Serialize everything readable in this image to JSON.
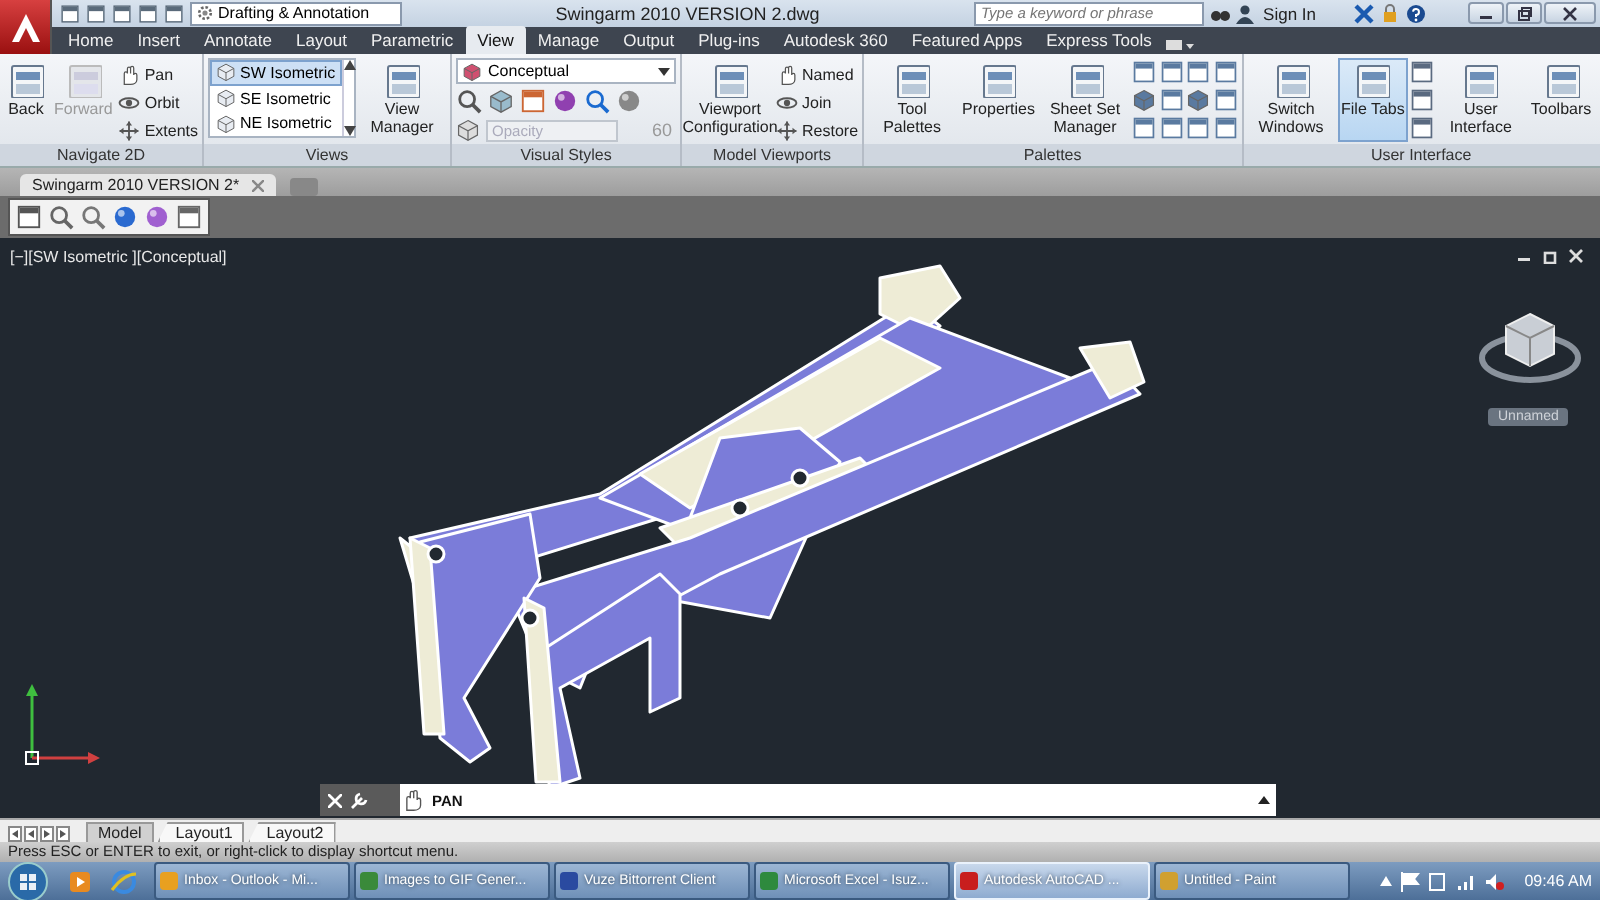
{
  "title_bar": {
    "workspace": "Drafting & Annotation",
    "title": "Swingarm 2010 VERSION 2.dwg",
    "search": {
      "placeholder": "Type a keyword or phrase"
    },
    "sign_in": "Sign In"
  },
  "ribbon_tabs": [
    {
      "label": "Home",
      "selected": false
    },
    {
      "label": "Insert",
      "selected": false
    },
    {
      "label": "Annotate",
      "selected": false
    },
    {
      "label": "Layout",
      "selected": false
    },
    {
      "label": "Parametric",
      "selected": false
    },
    {
      "label": "View",
      "selected": true
    },
    {
      "label": "Manage",
      "selected": false
    },
    {
      "label": "Output",
      "selected": false
    },
    {
      "label": "Plug-ins",
      "selected": false
    },
    {
      "label": "Autodesk 360",
      "selected": false
    },
    {
      "label": "Featured Apps",
      "selected": false
    },
    {
      "label": "Express Tools",
      "selected": false
    }
  ],
  "ribbon_panels": [
    {
      "title": "Navigate 2D",
      "groups": [
        {
          "kind": "large",
          "label": "Back",
          "disabled": false,
          "active": false
        },
        {
          "kind": "large",
          "label": "Forward",
          "disabled": true,
          "active": false
        },
        {
          "kind": "smalls",
          "items": [
            "Pan",
            "Orbit",
            "Extents"
          ]
        }
      ]
    },
    {
      "title": "Views",
      "groups": [
        {
          "kind": "list",
          "items": [
            {
              "label": "SW Isometric",
              "selected": true
            },
            {
              "label": "SE Isometric",
              "selected": false
            },
            {
              "label": "NE Isometric",
              "selected": false
            }
          ]
        },
        {
          "kind": "large",
          "label": "View Manager",
          "disabled": false,
          "active": false
        }
      ]
    },
    {
      "title": "Visual Styles",
      "groups": [
        {
          "kind": "visual",
          "style": "Conceptual",
          "opacity": {
            "placeholder": "Opacity"
          },
          "opacity_value": "60"
        }
      ]
    },
    {
      "title": "Model Viewports",
      "groups": [
        {
          "kind": "large",
          "label": "Viewport Configuration",
          "disabled": false,
          "active": false
        },
        {
          "kind": "smalls",
          "items": [
            "Named",
            "Join",
            "Restore"
          ]
        }
      ]
    },
    {
      "title": "Palettes",
      "groups": [
        {
          "kind": "large",
          "label": "Tool Palettes",
          "disabled": false,
          "active": false
        },
        {
          "kind": "large",
          "label": "Properties",
          "disabled": false,
          "active": false
        },
        {
          "kind": "large",
          "label": "Sheet Set Manager",
          "disabled": false,
          "active": false
        },
        {
          "kind": "icon_grid"
        },
        {
          "kind": "icon_grid"
        }
      ]
    },
    {
      "title": "User Interface",
      "groups": [
        {
          "kind": "large",
          "label": "Switch Windows",
          "disabled": false,
          "active": false
        },
        {
          "kind": "large",
          "label": "File Tabs",
          "disabled": false,
          "active": true
        },
        {
          "kind": "icon_column"
        },
        {
          "kind": "large",
          "label": "User Interface",
          "disabled": false,
          "active": false
        },
        {
          "kind": "large",
          "label": "Toolbars",
          "disabled": false,
          "active": false
        }
      ]
    }
  ],
  "file_tabs": [
    {
      "label": "Swingarm 2010 VERSION 2*",
      "selected": true
    }
  ],
  "viewport": {
    "label": "[−][SW Isometric ][Conceptual]",
    "ucs_badge": "Unnamed",
    "command": "PAN"
  },
  "layout_tabs": [
    {
      "kind": "model",
      "label": "Model",
      "selected": true
    },
    {
      "kind": "layout",
      "label": "Layout1",
      "selected": false
    },
    {
      "kind": "layout",
      "label": "Layout2",
      "selected": false
    }
  ],
  "status_bar": "Press ESC or ENTER to exit, or right-click to display shortcut menu.",
  "taskbar": {
    "items": [
      {
        "label": "Inbox - Outlook - Mi...",
        "selected": false,
        "color": "#e8a020"
      },
      {
        "label": "Images to GIF Gener...",
        "selected": false,
        "color": "#3a8a3a"
      },
      {
        "label": "Vuze Bittorrent Client",
        "selected": false,
        "color": "#2a4aa0"
      },
      {
        "label": "Microsoft Excel - Isuz...",
        "selected": false,
        "color": "#2e8a3e"
      },
      {
        "label": "Autodesk AutoCAD ...",
        "selected": true,
        "color": "#c81e1e"
      },
      {
        "label": "Untitled - Paint",
        "selected": false,
        "color": "#d0a030"
      }
    ],
    "clock": "09:46 AM"
  }
}
